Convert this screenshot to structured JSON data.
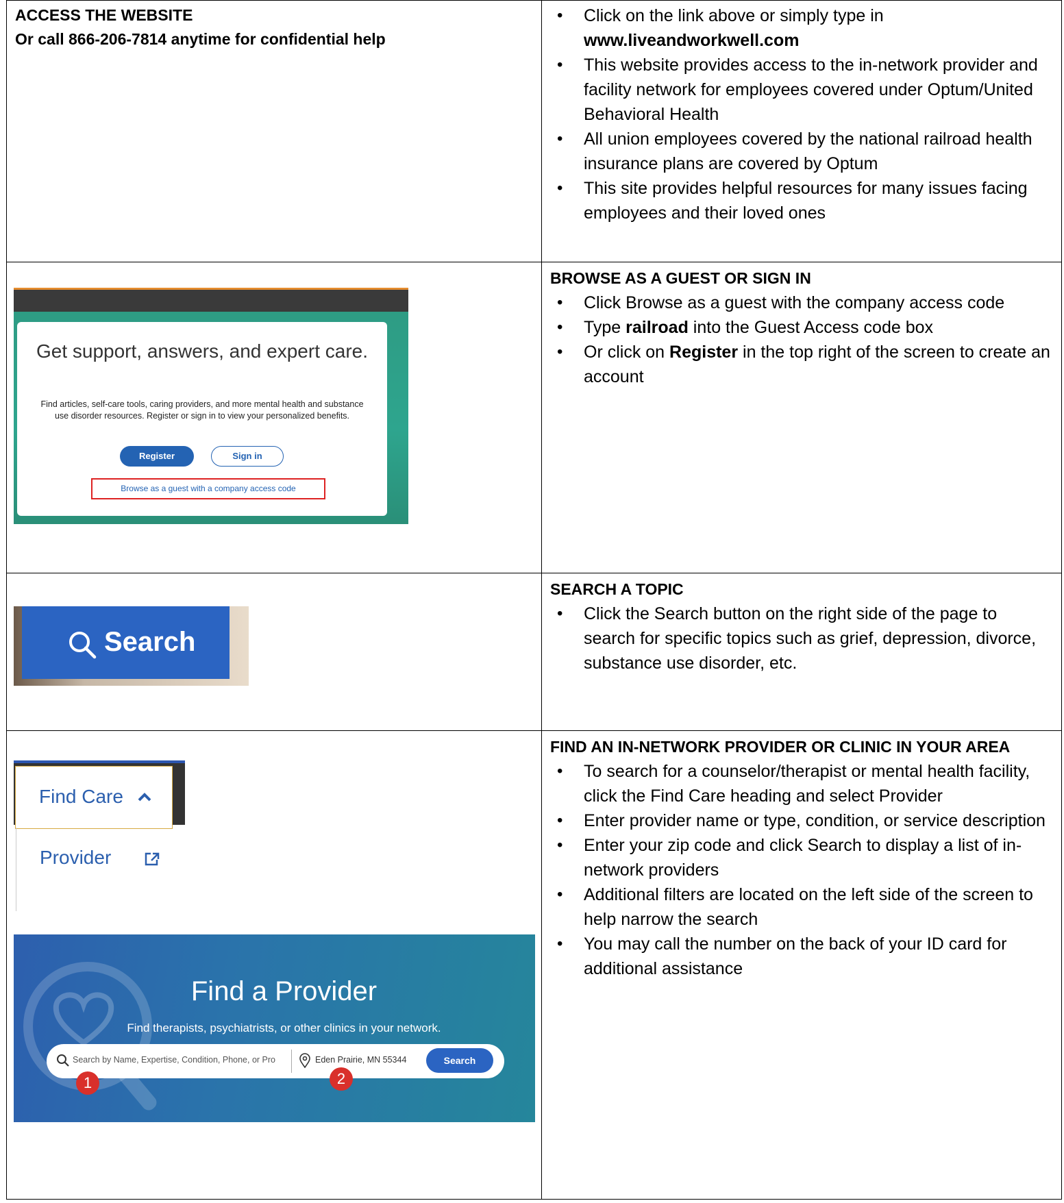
{
  "sections": {
    "access": {
      "heading1": "ACCESS THE WEBSITE",
      "heading2": "Or call 866-206-7814 anytime for confidential help",
      "b1_text": "Click on the link above or simply type in",
      "b1_url": "www.liveandworkwell.com",
      "b2": "This website provides access to the in-network provider and facility network for employees covered under Optum/United Behavioral Health",
      "b3": "All union employees covered by the national railroad health insurance plans are covered by Optum",
      "b4": "This site provides helpful resources for many issues facing employees and their loved ones"
    },
    "browse": {
      "heading": "BROWSE AS A GUEST OR SIGN IN",
      "b1": "Click Browse as a guest with the company access code",
      "b2_pre": "Type ",
      "b2_bold": "railroad",
      "b2_post": " into the Guest Access code box",
      "b3_pre": "Or click on ",
      "b3_bold": "Register",
      "b3_post": " in the top right of the screen to create an account"
    },
    "search": {
      "heading": "SEARCH A TOPIC",
      "b1": "Click the Search button on the right side of the page to search for specific topics such as grief, depression, divorce, substance use disorder, etc."
    },
    "find": {
      "heading": "FIND AN IN-NETWORK PROVIDER OR CLINIC IN YOUR AREA",
      "b1": "To search for a counselor/therapist or mental health facility, click the Find Care heading and select Provider",
      "b2": "Enter provider name or type, condition, or service description",
      "b3": "Enter your zip code and click Search to display a list of in-network providers",
      "b4": "Additional filters are located on the left side of the screen to help narrow the search",
      "b5": "You may call the number on the back of your ID card for additional assistance"
    }
  },
  "shot_support": {
    "title": "Get support, answers, and expert care.",
    "desc": "Find articles, self-care tools, caring providers, and more mental health and substance use disorder resources. Register or sign in to view your personalized benefits.",
    "register": "Register",
    "signin": "Sign in",
    "guest": "Browse as a guest with a company access code"
  },
  "shot_search": {
    "label": "Search",
    "icon": "search-icon"
  },
  "shot_findcare": {
    "label": "Find Care",
    "provider": "Provider",
    "icons": [
      "chevron-up-icon",
      "external-link-icon"
    ]
  },
  "shot_provider": {
    "title": "Find a Provider",
    "subtitle": "Find therapists, psychiatrists, or other clinics in your network.",
    "placeholder": "Search by Name, Expertise, Condition, Phone, or Progra",
    "location": "Eden Prairie, MN 55344",
    "search_btn": "Search",
    "badge1": "1",
    "badge2": "2"
  },
  "colors": {
    "blue": "#2b64c2",
    "link": "#2b5fae",
    "badge": "#d9302b",
    "highlight": "#dd2222"
  }
}
